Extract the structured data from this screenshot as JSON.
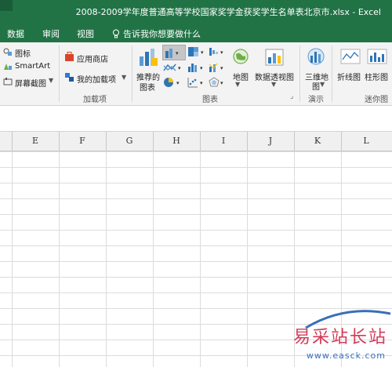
{
  "window": {
    "title": "2008-2009学年度普通高等学校国家奖学金获奖学生名单表北京市.xlsx  -  Excel"
  },
  "tabs": [
    {
      "label": "数据"
    },
    {
      "label": "审阅"
    },
    {
      "label": "视图"
    }
  ],
  "tell_me": {
    "label": "告诉我你想要做什么",
    "icon": "lightbulb-icon"
  },
  "ribbon": {
    "illustrations": {
      "icons_label": "图标",
      "smartart_label": "SmartArt",
      "screenshot_label": "屏幕截图"
    },
    "addins": {
      "store_label": "应用商店",
      "my_addins_label": "我的加载项",
      "group_label": "加载项"
    },
    "charts": {
      "recommended_label": [
        "推荐的",
        "图表"
      ],
      "map_label": "地图",
      "pivot_chart_label": "数据透视图",
      "group_label": "图表",
      "launcher_glyph": "⌟"
    },
    "tours": {
      "map3d_label": [
        "三维地",
        "图"
      ],
      "group_label": "演示"
    },
    "sparklines": {
      "line_label": "折线图",
      "column_label": "柱形图",
      "group_label": "迷你图"
    }
  },
  "sheet": {
    "columns": [
      "E",
      "F",
      "G",
      "H",
      "I",
      "J",
      "K",
      "L"
    ]
  },
  "watermark": {
    "title": "易采站长站",
    "url": "www.easck.com"
  },
  "colors": {
    "excel_green": "#217346",
    "ribbon_bg": "#f3f3f3",
    "watermark_red": "#d23c5a",
    "watermark_blue": "#3a6fb8"
  }
}
